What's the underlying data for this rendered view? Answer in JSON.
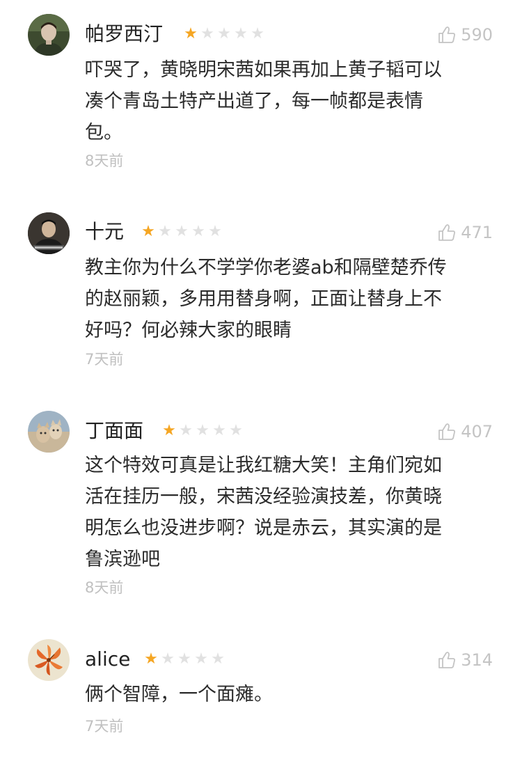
{
  "reviews": [
    {
      "username": "帕罗西汀",
      "rating": 1,
      "likes": "590",
      "content_lines": [
        "吓哭了，黄晓明宋茜如果再加上黄子韬可以",
        "凑个青岛土特产出道了，每一帧都是表情",
        "包。"
      ],
      "time": "8天前"
    },
    {
      "username": "十元",
      "rating": 1,
      "likes": "471",
      "content_lines": [
        "教主你为什么不学学你老婆ab和隔壁楚乔传",
        "的赵丽颖，多用用替身啊，正面让替身上不",
        "好吗？何必辣大家的眼睛"
      ],
      "time": "7天前"
    },
    {
      "username": "丁面面",
      "rating": 1,
      "likes": "407",
      "content_lines": [
        "这个特效可真是让我红糖大笑！主角们宛如",
        "活在挂历一般，宋茜没经验演技差，你黄晓",
        "明怎么也没进步啊？说是赤云，其实演的是",
        "鲁滨逊吧"
      ],
      "time": "8天前"
    },
    {
      "username": "alice",
      "rating": 1,
      "likes": "314",
      "content_lines": [
        "俩个智障，一个面瘫。"
      ],
      "time": "7天前"
    }
  ],
  "colors": {
    "star_on": "#f5a623",
    "star_off": "#e1e1e1",
    "muted": "#c0c0c0"
  }
}
